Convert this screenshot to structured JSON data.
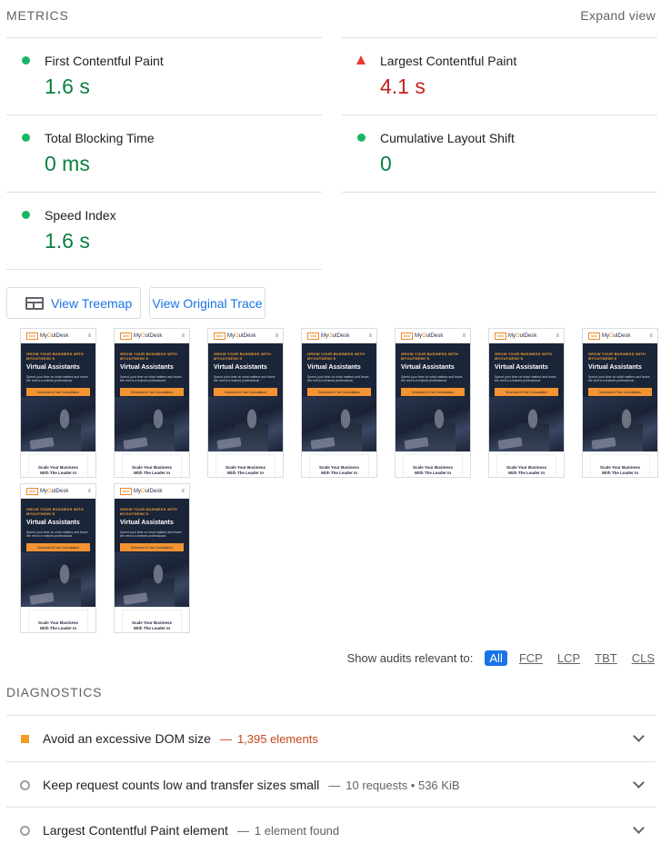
{
  "metrics": {
    "title": "METRICS",
    "expand_label": "Expand view",
    "items": [
      {
        "label": "First Contentful Paint",
        "value": "1.6 s",
        "status": "pass"
      },
      {
        "label": "Largest Contentful Paint",
        "value": "4.1 s",
        "status": "fail"
      },
      {
        "label": "Total Blocking Time",
        "value": "0 ms",
        "status": "pass"
      },
      {
        "label": "Cumulative Layout Shift",
        "value": "0",
        "status": "pass"
      },
      {
        "label": "Speed Index",
        "value": "1.6 s",
        "status": "pass"
      }
    ]
  },
  "buttons": {
    "treemap_label": "View Treemap",
    "trace_label": "View Original Trace"
  },
  "filmstrip": {
    "frame_count": 9,
    "frame": {
      "logo_badge": "MOD",
      "brand_prefix": "My",
      "brand_accent": "O",
      "brand_suffix": "utDesk",
      "menu_icon": "hamburger-icon",
      "kicker": "GROW YOUR BUSINESS WITH MYOUTDESK'S",
      "title": "Virtual Assistants",
      "subtitle": "Spend your time on what matters and leave the rest to a trained professional.",
      "cta": "Schedule A Free Consultation",
      "footer_line1": "Scale Your Business",
      "footer_line2": "With The Leader In"
    }
  },
  "filters": {
    "label": "Show audits relevant to:",
    "chips": [
      "All",
      "FCP",
      "LCP",
      "TBT",
      "CLS"
    ],
    "active": "All"
  },
  "diagnostics": {
    "title": "DIAGNOSTICS",
    "items": [
      {
        "title": "Avoid an excessive DOM size",
        "separator": "—",
        "detail": "1,395 elements",
        "status": "warn"
      },
      {
        "title": "Keep request counts low and transfer sizes small",
        "separator": "—",
        "detail": "10 requests • 536 KiB",
        "status": "info"
      },
      {
        "title": "Largest Contentful Paint element",
        "separator": "—",
        "detail": "1 element found",
        "status": "info"
      }
    ]
  },
  "colors": {
    "pass": "#0b8043",
    "fail": "#c5221f",
    "warn": "#f39b25",
    "link": "#1a73e8"
  }
}
